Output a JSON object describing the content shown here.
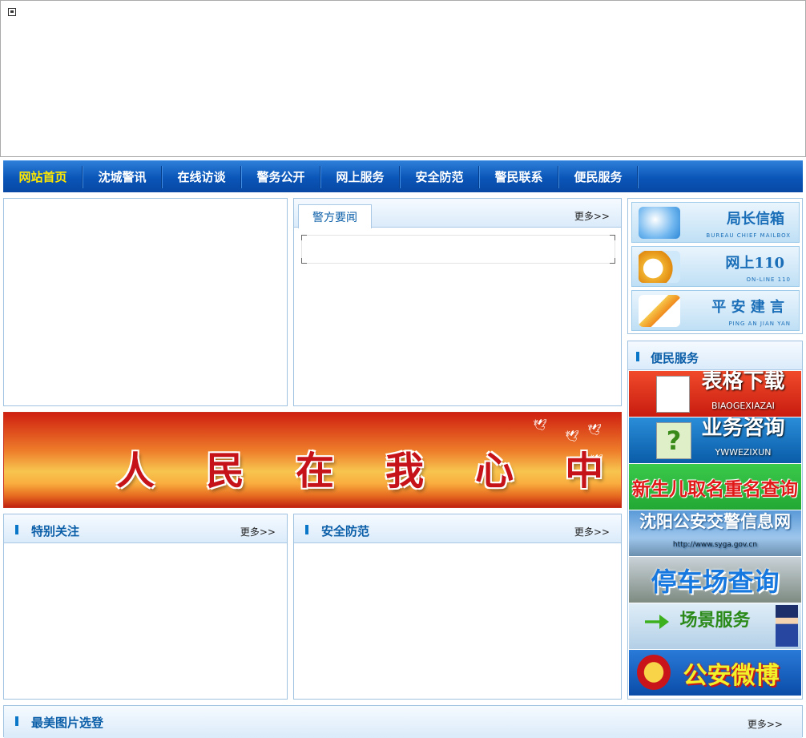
{
  "nav": {
    "items": [
      "网站首页",
      "沈城警讯",
      "在线访谈",
      "警务公开",
      "网上服务",
      "安全防范",
      "警民联系",
      "便民服务"
    ]
  },
  "news": {
    "tab": "警方要闻",
    "more": "更多>>"
  },
  "banner": {
    "text": [
      "人",
      "民",
      "在",
      "我",
      "心",
      "中"
    ]
  },
  "special": {
    "title": "特别关注",
    "more": "更多>>"
  },
  "safety": {
    "title": "安全防范",
    "more": "更多>>"
  },
  "photos": {
    "title": "最美图片选登",
    "more": "更多>>"
  },
  "services": [
    {
      "title": "局长信箱",
      "sub": "BUREAU CHIEF MAILBOX",
      "icon": "mail-icon"
    },
    {
      "title": "网上110",
      "sub": "ON-LINE 110",
      "icon": "ie-icon"
    },
    {
      "title": "平 安 建 言",
      "sub": "PING AN JIAN YAN",
      "icon": "pen-icon"
    }
  ],
  "convenience": {
    "title": "便民服务",
    "links": [
      {
        "title": "表格下载",
        "sub": "BIAOGEXIAZAI"
      },
      {
        "title": "业务咨询",
        "sub": "YWWEZIXUN"
      },
      {
        "title": "新生儿取名重名查询",
        "sub": ""
      },
      {
        "title": "沈阳公安交警信息网",
        "sub": "http://www.syga.gov.cn"
      },
      {
        "title": "停车场查询",
        "sub": ""
      },
      {
        "title": "场景服务",
        "sub": ""
      },
      {
        "title": "公安微博",
        "sub": ""
      }
    ]
  },
  "colors": {
    "nav": "#0a55b8",
    "accent": "#ffe800",
    "title": "#0b5ea8"
  }
}
